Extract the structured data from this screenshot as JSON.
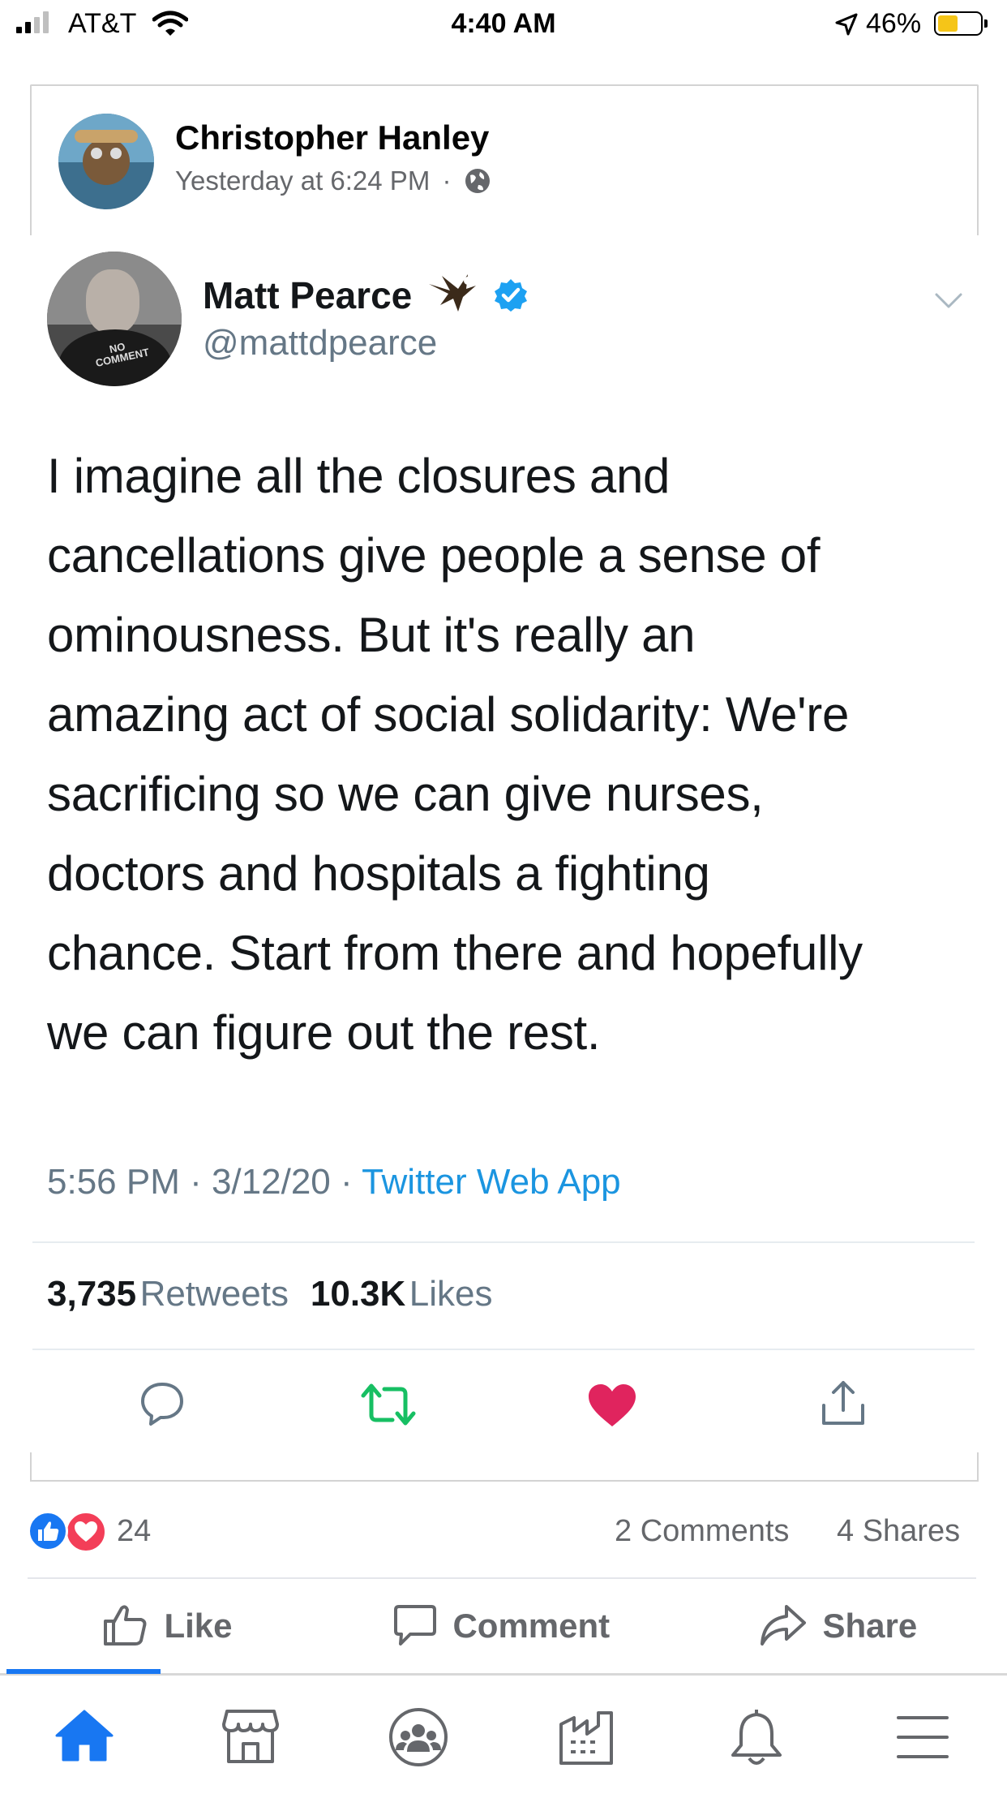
{
  "status_bar": {
    "carrier": "AT&T",
    "time": "4:40 AM",
    "battery": "46%"
  },
  "post": {
    "author": "Christopher Hanley",
    "timestamp": "Yesterday at 6:24 PM",
    "separator": "·",
    "privacy_icon": "globe-icon"
  },
  "tweet": {
    "name": "Matt Pearce",
    "handle": "@mattdpearce",
    "avatar_shirt_text": "NO COMMENT",
    "lines": [
      "I imagine all the closures and",
      "cancellations give people a sense of",
      "ominousness. But it's really an",
      "amazing act of social solidarity: We're",
      "sacrificing so we can give nurses,",
      "doctors and hospitals a fighting",
      "chance. Start from there and hopefully",
      "we can figure out the rest."
    ],
    "time": "5:56 PM · 3/12/20 · ",
    "source": "Twitter Web App",
    "retweets_count": "3,735",
    "retweets_label": "Retweets",
    "likes_count": "10.3K",
    "likes_label": "Likes",
    "colors": {
      "verified": "#1da1f2",
      "retweet": "#17bf63",
      "like": "#e0245e"
    }
  },
  "reactions": {
    "count": "24",
    "comments": "2 Comments",
    "shares": "4 Shares"
  },
  "actions": {
    "like": "Like",
    "comment": "Comment",
    "share": "Share"
  },
  "nav": {
    "accent": "#1877f2",
    "items": [
      "home-icon",
      "marketplace-icon",
      "groups-icon",
      "pages-icon",
      "notifications-icon",
      "menu-icon"
    ]
  }
}
